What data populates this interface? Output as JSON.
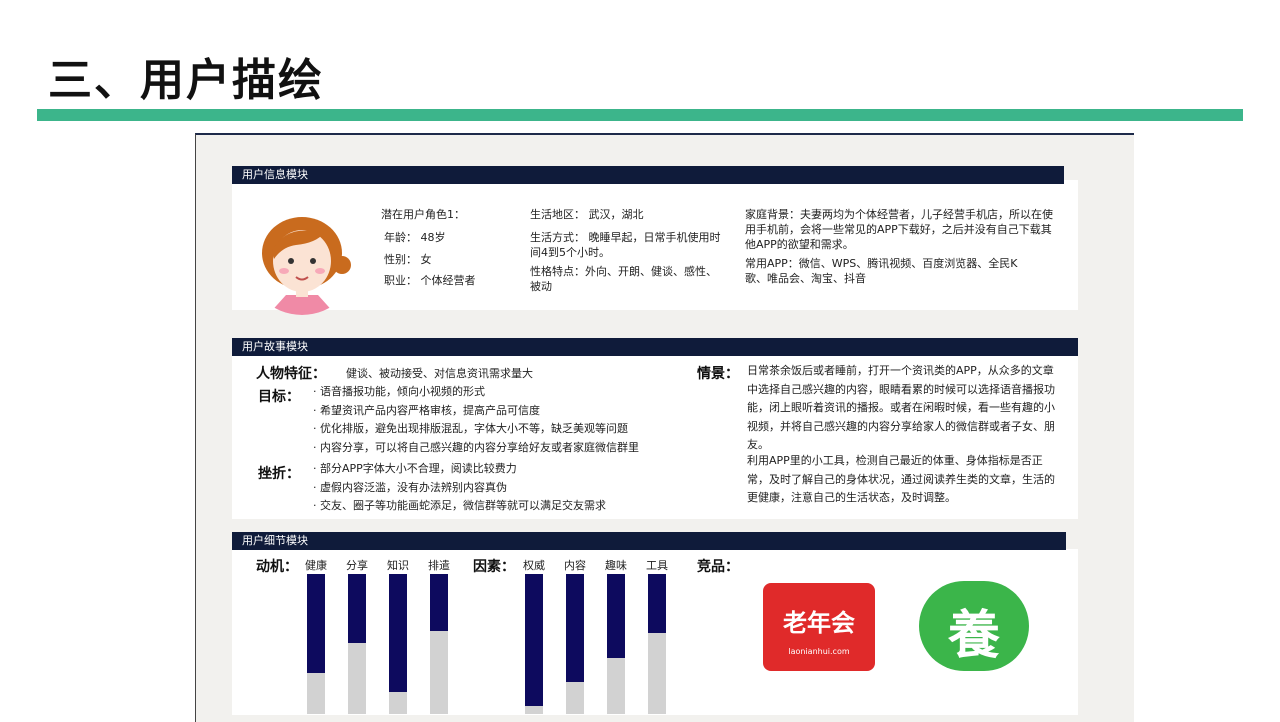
{
  "title": "三、用户描绘",
  "info": {
    "header": "用户信息模块",
    "role": "潜在用户角色1：",
    "age": "年龄： 48岁",
    "gender": "性别： 女",
    "job": "职业： 个体经营者",
    "region": "生活地区： 武汉，湖北",
    "lifestyle": "生活方式： 晚睡早起，日常手机使用时间4到5个小时。",
    "personality": "性格特点：外向、开朗、健谈、感性、被动",
    "family": "家庭背景：夫妻两均为个体经营者，儿子经营手机店，所以在使用手机前，会将一些常见的APP下载好，之后并没有自己下载其他APP的欲望和需求。",
    "apps": "常用APP：微信、WPS、腾讯视频、百度浏览器、全民K歌、唯品会、淘宝、抖音"
  },
  "story": {
    "header": "用户故事模块",
    "traits_label": "人物特征：",
    "traits": "健谈、被动接受、对信息资讯需求量大",
    "goals_label": "目标：",
    "goals": [
      "语音播报功能，倾向小视频的形式",
      "希望资讯产品内容严格审核，提高产品可信度",
      "优化排版，避免出现排版混乱，字体大小不等，缺乏美观等问题",
      "内容分享，可以将自己感兴趣的内容分享给好友或者家庭微信群里"
    ],
    "frustrations_label": "挫折：",
    "frustrations": [
      "部分APP字体大小不合理，阅读比较费力",
      "虚假内容泛滥，没有办法辨别内容真伪",
      "交友、圈子等功能画蛇添足，微信群等就可以满足交友需求"
    ],
    "scene_label": "情景：",
    "scene_1": "日常茶余饭后或者睡前，打开一个资讯类的APP，从众多的文章中选择自己感兴趣的内容，眼睛看累的时候可以选择语音播报功能，闭上眼听着资讯的播报。或者在闲暇时候，看一些有趣的小视频，并将自己感兴趣的内容分享给家人的微信群或者子女、朋友。",
    "scene_2": "利用APP里的小工具，检测自己最近的体重、身体指标是否正常，及时了解自己的身体状况，通过阅读养生类的文章，生活的更健康，注意自己的生活状态，及时调整。"
  },
  "detail": {
    "header": "用户细节模块",
    "motivation_label": "动机：",
    "motivation_bars": [
      {
        "label": "健康",
        "value": 0.71
      },
      {
        "label": "分享",
        "value": 0.49
      },
      {
        "label": "知识",
        "value": 0.84
      },
      {
        "label": "排遣",
        "value": 0.41
      }
    ],
    "factors_label": "因素：",
    "factor_bars": [
      {
        "label": "权威",
        "value": 0.94
      },
      {
        "label": "内容",
        "value": 0.77
      },
      {
        "label": "趣味",
        "value": 0.6
      },
      {
        "label": "工具",
        "value": 0.42
      }
    ],
    "competitors_label": "竞品：",
    "competitors": [
      {
        "name": "老年会",
        "url": "laonianhui.com"
      },
      {
        "name": "養",
        "url": ""
      }
    ]
  },
  "colors": {
    "accent": "#3cb58b",
    "navy": "#0f1b3a",
    "bar_fill": "#0d0a5e",
    "bar_bg": "#d2d2d2"
  }
}
